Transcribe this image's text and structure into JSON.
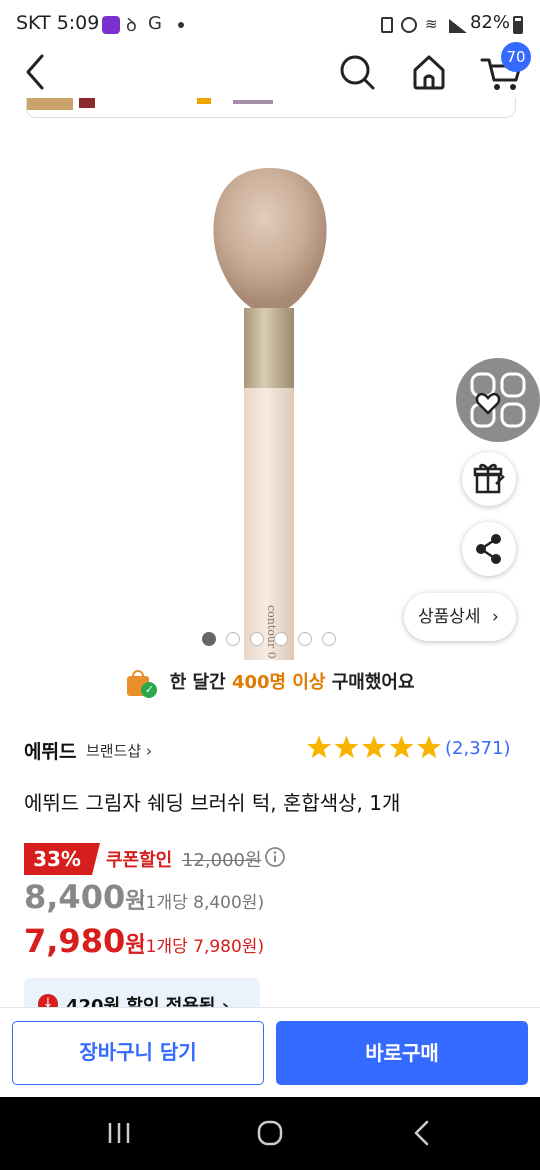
{
  "status_bar": {
    "carrier_time": "SKT 5:09",
    "battery": "82%"
  },
  "header": {
    "cart_count": "70",
    "icons": [
      "back-icon",
      "search-icon",
      "home-icon",
      "cart-icon"
    ]
  },
  "product": {
    "image_pages": 6,
    "current_page": 1,
    "purchase_stat": {
      "prefix": "한 달간 ",
      "highlight": "400명 이상",
      "suffix": " 구매했어요"
    },
    "detail_button": "상품상세",
    "brand": "에뛰드",
    "brand_shop": "브랜드샵",
    "rating_stars": 5,
    "review_count": "(2,371)",
    "title": "에뛰드 그림자 쉐딩 브러쉬 턱, 혼합색상, 1개",
    "discount_rate": "33%",
    "coupon_label": "쿠폰할인",
    "original_price": "12,000원",
    "price": "8,400",
    "price_won": "원",
    "price_unit": "(1개당 8,400원)",
    "coupon_price": "7,980",
    "coupon_price_won": "원",
    "coupon_price_unit": "(1개당 7,980원)",
    "discount_applied": "420원 할인 적용됨"
  },
  "actions": {
    "add_to_cart": "장바구니 담기",
    "buy_now": "바로구매"
  },
  "colors": {
    "accent": "#346aff",
    "sale_red": "#d81d1d",
    "highlight_orange": "#e07a00",
    "star": "#f8b400"
  }
}
